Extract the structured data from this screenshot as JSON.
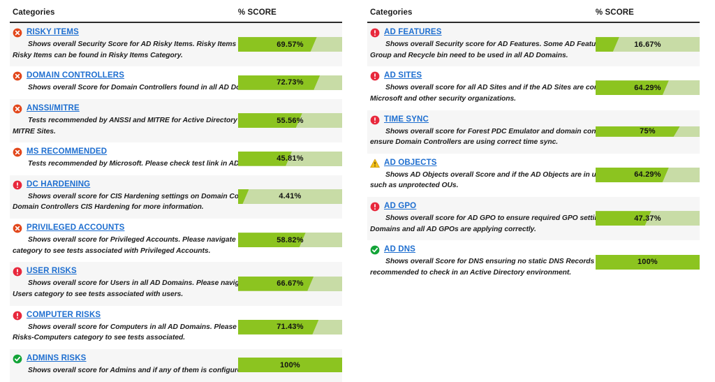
{
  "colors": {
    "link": "#1f6fd0",
    "bar_track": "#c8dca6",
    "bar_fill": "#8cc420",
    "icon_critical": "#e2471b",
    "icon_high": "#e8283c",
    "icon_warning": "#f5c21a",
    "icon_ok": "#13a438",
    "row_stripe": "#f6f6f6",
    "header_rule": "#2a2a2a"
  },
  "tables": [
    {
      "id": "left",
      "headers": {
        "category": "Categories",
        "score": "% SCORE"
      },
      "rows": [
        {
          "status": "critical",
          "title": "RISKY ITEMS",
          "description": "Shows overall Security Score for AD Risky Items. Risky Items need to be addressed ASAP. Risky Items can be found in Risky Items Category.",
          "score_label": "69.57%",
          "score_value": 69.57
        },
        {
          "status": "critical",
          "title": "DOMAIN CONTROLLERS",
          "description": "Shows overall Score for Domain Controllers found in all AD Domains in AD Forest.",
          "score_label": "72.73%",
          "score_value": 72.73
        },
        {
          "status": "critical",
          "title": "ANSSI/MITRE",
          "description": "Tests recommended by ANSSI and MITRE for Active Directory can be found on ANSSI and MITRE Sites.",
          "score_label": "55.56%",
          "score_value": 55.56
        },
        {
          "status": "critical",
          "title": "MS RECOMMENDED",
          "description": "Tests recommended by Microsoft. Please check test link in AD Status for more information.",
          "score_label": "45.81%",
          "score_value": 45.81
        },
        {
          "status": "high",
          "title": "DC HARDENING",
          "description": "Shows overall score for CIS Hardening settings on Domain Controllers. Please check Domain Controllers CIS Hardening for more information.",
          "score_label": "4.41%",
          "score_value": 4.41
        },
        {
          "status": "critical",
          "title": "PRIVILEGED ACCOUNTS",
          "description": "Shows overall score for Privileged Accounts. Please navigate to Privileged Accounts category to see tests associated with Privileged Accounts.",
          "score_label": "58.82%",
          "score_value": 58.82
        },
        {
          "status": "high",
          "title": "USER RISKS",
          "description": "Shows overall score for Users in all AD Domains. Please navigate to AD Security Risks-Users category to see tests associated with users.",
          "score_label": "66.67%",
          "score_value": 66.67
        },
        {
          "status": "high",
          "title": "COMPUTER RISKS",
          "description": "Shows overall score for Computers in all AD Domains. Please navigate to AD Security Risks-Computers category to see tests associated.",
          "score_label": "71.43%",
          "score_value": 71.43
        },
        {
          "status": "ok",
          "title": "ADMINS RISKS",
          "description": "Shows overall score for Admins and if any of them is configured with SPNs",
          "score_label": "100%",
          "score_value": 100
        }
      ]
    },
    {
      "id": "right",
      "headers": {
        "category": "Categories",
        "score": "% SCORE"
      },
      "rows": [
        {
          "status": "high",
          "title": "AD FEATURES",
          "description": "Shows overall Security score for AD Features. Some AD Features such as Protected Users Group and Recycle bin need to be used in all AD Domains.",
          "score_label": "16.67%",
          "score_value": 16.67
        },
        {
          "status": "high",
          "title": "AD SITES",
          "description": "Shows overall score for all AD Sites and if the AD Sites are configured correctly and as per Microsoft and other security organizations.",
          "score_label": "64.29%",
          "score_value": 64.29
        },
        {
          "status": "high",
          "title": "TIME SYNC",
          "description": "Shows overall score for Forest PDC Emulator and domain controllers in all AD Domains to ensure Domain Controllers are using correct time sync.",
          "score_label": "75%",
          "score_value": 75,
          "thin": true
        },
        {
          "status": "warning",
          "title": "AD OBJECTS",
          "description": "Shows AD Objects overall Score and if the AD Objects are in use and configured correctly such as unprotected OUs.",
          "score_label": "64.29%",
          "score_value": 64.29
        },
        {
          "status": "high",
          "title": "AD GPO",
          "description": "Shows overall score for AD GPO to ensure required GPO settings are configured in the AD Domains and all AD GPOs are applying correctly.",
          "score_label": "47.37%",
          "score_value": 47.37
        },
        {
          "status": "ok",
          "title": "AD DNS",
          "description": "Shows overall Score for DNS ensuring no static DNS Records and other tests which are recommended to check in an Active Directory environment.",
          "score_label": "100%",
          "score_value": 100
        }
      ]
    }
  ],
  "icon_names": {
    "critical": "error-circle-icon",
    "high": "alert-circle-icon",
    "warning": "warning-triangle-icon",
    "ok": "check-circle-icon"
  }
}
